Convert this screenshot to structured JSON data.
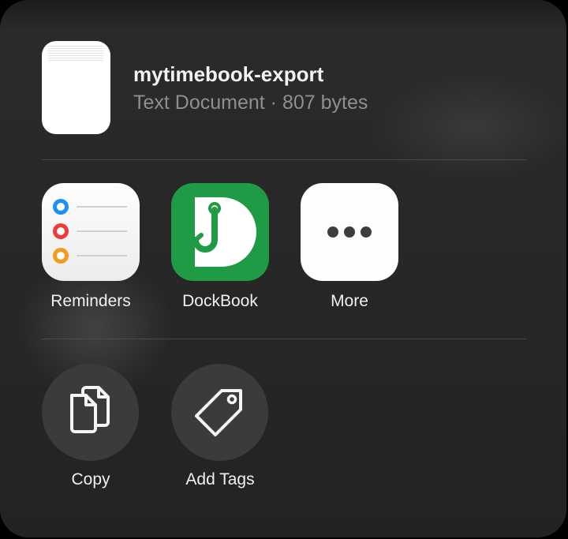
{
  "file": {
    "name": "mytimebook-export",
    "meta": "Text Document · 807 bytes",
    "thumbnail_icon": "text-document-thumbnail"
  },
  "apps": [
    {
      "label": "Reminders",
      "icon": "reminders-icon"
    },
    {
      "label": "DockBook",
      "icon": "dockbook-icon",
      "color": "#1f9a45"
    },
    {
      "label": "More",
      "icon": "more-icon"
    }
  ],
  "actions": [
    {
      "label": "Copy",
      "icon": "copy-icon"
    },
    {
      "label": "Add Tags",
      "icon": "tag-icon"
    }
  ],
  "colors": {
    "sheet_bg": "#2b2b2b",
    "action_bg": "#3b3b3b",
    "reminder_dots": [
      "#1e8ff5",
      "#f03a3a",
      "#f59a1a"
    ]
  }
}
